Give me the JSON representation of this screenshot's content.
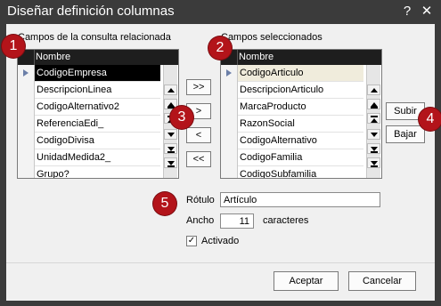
{
  "window": {
    "title": "Diseñar definición columnas",
    "help_glyph": "?",
    "close_glyph": "✕"
  },
  "left_panel": {
    "label": "Campos de la consulta relacionada",
    "column_header": "Nombre",
    "rows": [
      "CodigoEmpresa",
      "DescripcionLinea",
      "CodigoAlternativo2",
      "ReferenciaEdi_",
      "CodigoDivisa",
      "UnidadMedida2_",
      "Grupo?"
    ]
  },
  "right_panel": {
    "label": "Campos seleccionados",
    "column_header": "Nombre",
    "rows": [
      "CodigoArticulo",
      "DescripcionArticulo",
      "MarcaProducto",
      "RazonSocial",
      "CodigoAlternativo",
      "CodigoFamilia",
      "CodigoSubfamilia"
    ]
  },
  "transfer_buttons": {
    "add_all": ">>",
    "add_one": ">",
    "remove_one": "<",
    "remove_all": "<<"
  },
  "order_buttons": {
    "up": "Subir",
    "down": "Bajar"
  },
  "properties": {
    "rotulo_label": "Rótulo",
    "rotulo_value": "Artículo",
    "ancho_label": "Ancho",
    "ancho_value": "11",
    "ancho_units": "caracteres",
    "activado_label": "Activado",
    "activado_checked": true,
    "check_glyph": "✓"
  },
  "footer": {
    "accept": "Aceptar",
    "cancel": "Cancelar"
  },
  "badges": [
    "1",
    "2",
    "3",
    "4",
    "5"
  ],
  "colors": {
    "badge": "#b3141a",
    "titlebar": "#3b3b3b",
    "grid_header": "#1e1e1e"
  }
}
